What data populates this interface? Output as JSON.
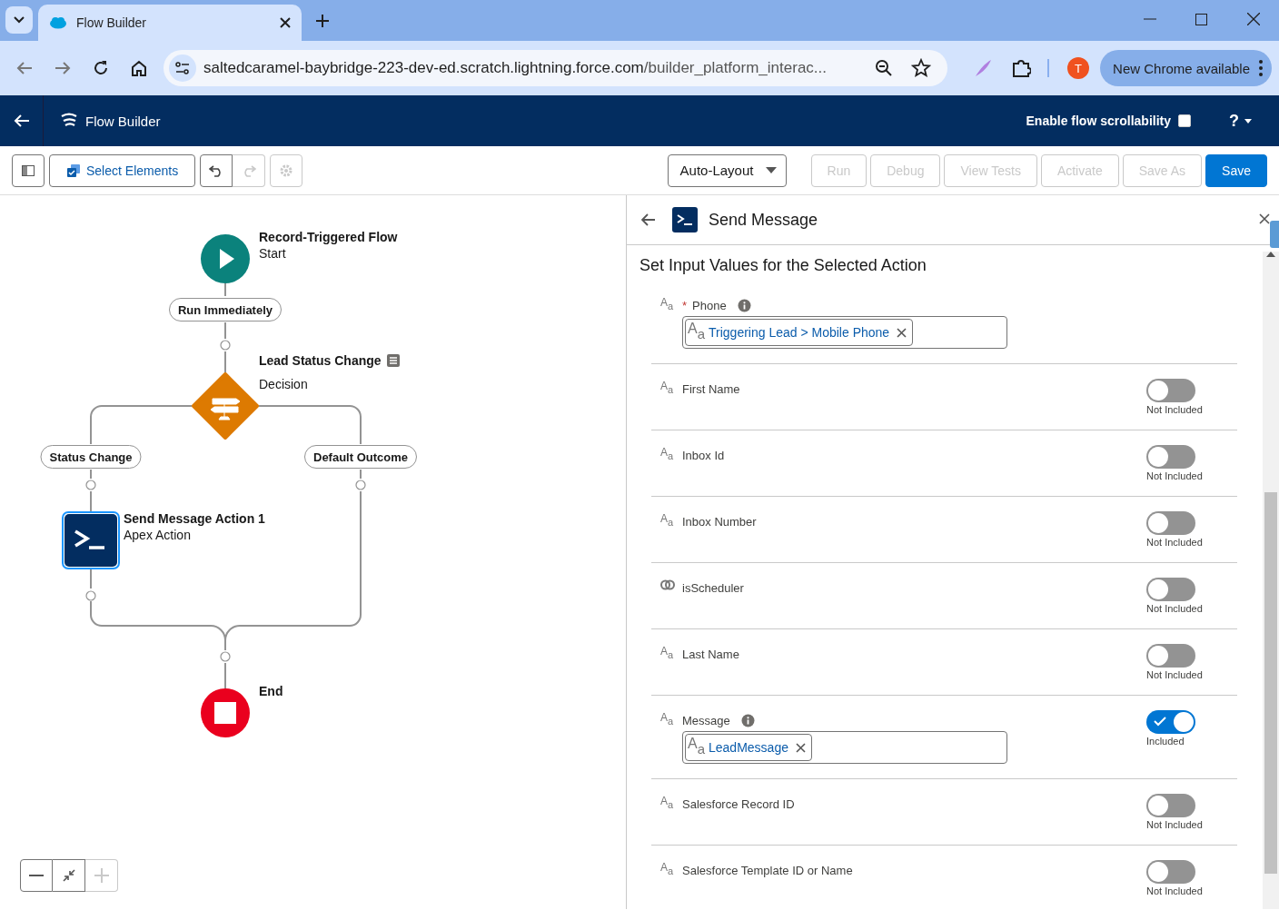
{
  "browser": {
    "tab_title": "Flow Builder",
    "url_host": "saltedcaramel-baybridge-223-dev-ed.scratch.lightning.force.com",
    "url_path": "/builder_platform_interac...",
    "profile_initial": "T",
    "update_label": "New Chrome available"
  },
  "app_header": {
    "title": "Flow Builder",
    "scrollability_label": "Enable flow scrollability",
    "scrollability_checked": false,
    "help": "?"
  },
  "toolbar": {
    "select_elements": "Select Elements",
    "undo_disabled": false,
    "redo_disabled": true,
    "settings_disabled": true,
    "layout": "Auto-Layout",
    "buttons": [
      {
        "label": "Run",
        "kind": "neutral",
        "disabled": true
      },
      {
        "label": "Debug",
        "kind": "neutral",
        "disabled": true
      },
      {
        "label": "View Tests",
        "kind": "neutral",
        "disabled": true
      },
      {
        "label": "Activate",
        "kind": "neutral",
        "disabled": true
      },
      {
        "label": "Save As",
        "kind": "neutral",
        "disabled": true
      },
      {
        "label": "Save",
        "kind": "primary",
        "disabled": false
      }
    ]
  },
  "canvas": {
    "nodes": [
      {
        "kind": "start",
        "title": "Record-Triggered Flow",
        "subtitle": "Start",
        "selected": false
      },
      {
        "kind": "decision",
        "title": "Lead Status Change",
        "subtitle": "Decision",
        "selected": false,
        "has_description": true
      },
      {
        "kind": "action",
        "title": "Send Message Action 1",
        "subtitle": "Apex Action",
        "selected": true
      },
      {
        "kind": "end",
        "title": "End",
        "selected": false
      }
    ],
    "outcomes": [
      "Run Immediately",
      "Status Change",
      "Default Outcome"
    ],
    "zoom_controls": [
      {
        "kind": "zoom-out",
        "disabled": false
      },
      {
        "kind": "fit",
        "disabled": false
      },
      {
        "kind": "zoom-in",
        "disabled": true
      }
    ]
  },
  "panel": {
    "title": "Send Message",
    "heading": "Set Input Values for the Selected Action",
    "fields": [
      {
        "kind": "text",
        "type_icon": "A$_{a}$",
        "label": "Phone",
        "required": true,
        "required_mark": "*",
        "info": true,
        "value_icon": "A$_{a}$",
        "value": "Triggering Lead > Mobile Phone"
      },
      {
        "kind": "text",
        "type_icon": "A$_{a}$",
        "label": "First Name",
        "required": false,
        "info": false,
        "included": false,
        "status": "Not Included"
      },
      {
        "kind": "text",
        "type_icon": "A$_{a}$",
        "label": "Inbox Id",
        "required": false,
        "info": false,
        "included": false,
        "status": "Not Included"
      },
      {
        "kind": "text",
        "type_icon": "A$_{a}$",
        "label": "Inbox Number",
        "required": false,
        "info": false,
        "included": false,
        "status": "Not Included"
      },
      {
        "kind": "boolean",
        "label": "isScheduler",
        "required": false,
        "info": false,
        "included": false,
        "status": "Not Included"
      },
      {
        "kind": "text",
        "type_icon": "A$_{a}$",
        "label": "Last Name",
        "required": false,
        "info": false,
        "included": false,
        "status": "Not Included"
      },
      {
        "kind": "text",
        "type_icon": "A$_{a}$",
        "label": "Message",
        "required": false,
        "info": true,
        "included": true,
        "status": "Included",
        "value_icon": "A$_{a}$",
        "value": "LeadMessage"
      },
      {
        "kind": "text",
        "type_icon": "A$_{a}$",
        "label": "Salesforce Record ID",
        "required": false,
        "info": false,
        "included": false,
        "status": "Not Included"
      },
      {
        "kind": "text",
        "type_icon": "A$_{a}$",
        "label": "Salesforce Template ID or Name",
        "required": false,
        "info": false,
        "included": false,
        "status": "Not Included"
      }
    ]
  }
}
